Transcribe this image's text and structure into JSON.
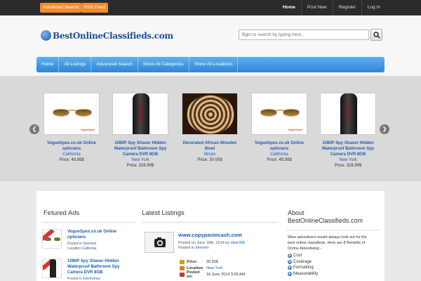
{
  "topbar": {
    "advanced_search": "Advanced Search",
    "rss_feed": "RSS Feed",
    "nav": [
      "Home",
      "Post New",
      "Register",
      "Log In"
    ]
  },
  "header": {
    "logo_text": "BestOnlineClassifieds.com",
    "search_placeholder": "Bgin to search by typing here...",
    "nav": [
      "Home",
      "All Listings",
      "Advanced Search",
      "Show All Categories",
      "Show All Locations"
    ]
  },
  "slider": {
    "items": [
      {
        "title_lines": [
          "VogueSpex.co.uk Online opticians",
          ""
        ],
        "location": "California",
        "price": "Price: 49.99$",
        "thumb": "sunglasses",
        "brand": "VogueSpex"
      },
      {
        "title_lines": [
          "1080P Spy Shaver Hidden",
          "Waterproof Bathroom Spy",
          "Camera DVR 8GB"
        ],
        "location": "New York",
        "price": "Price: 328.99$",
        "thumb": "shaver"
      },
      {
        "title_lines": [
          "Decorated African Wooden Bowl",
          ""
        ],
        "location": "Illinois",
        "price": "Price: 30.00$",
        "thumb": "bowl"
      },
      {
        "title_lines": [
          "VogueSpex.co.uk Online opticians",
          ""
        ],
        "location": "California",
        "price": "Price: 49.99$",
        "thumb": "sunglasses",
        "brand": "VogueSpex"
      },
      {
        "title_lines": [
          "1080P Spy Shaver Hidden",
          "Waterproof Bathroom Spy",
          "Camera DVR 8GB"
        ],
        "location": "New York",
        "price": "Price: 328.99$",
        "thumb": "shaver"
      }
    ]
  },
  "featured": {
    "title": "Fetured Ads",
    "items": [
      {
        "title_lines": [
          "VogueSpex.co.uk Online",
          "opticians"
        ],
        "posted_label": "Posted in",
        "category": "Services",
        "location_label": "Location",
        "location": "California"
      },
      {
        "title_lines": [
          "1080P Spy Shaver Hidden",
          "Waterproof Bathroom Spy",
          "Camera DVR 8GB"
        ],
        "posted_label": "Posted in",
        "category": "Electronics"
      }
    ]
  },
  "latest": {
    "title": "Latest Listings",
    "item": {
      "title": "www.copypastecash.com",
      "posted_on": "Posted on June 16th, 2014 by",
      "author": "disie306",
      "posted_in_label": "Posted in",
      "category": "Internet",
      "details": [
        {
          "label": "Price:",
          "value": "29.95$",
          "link": false,
          "color": "#d4a017"
        },
        {
          "label": "Location:",
          "value": "New York",
          "link": true,
          "color": "#e07b2a"
        },
        {
          "label": "Posted on:",
          "value": "16 June 2014 3:25 AM",
          "link": false,
          "color": "#c0392b"
        }
      ]
    }
  },
  "about": {
    "title_lines": [
      "About",
      "BestOnlineClassifieds.com"
    ],
    "text_lines": [
      "Wise advertisers would always look out for the",
      "best online classifieds. Here are 8 Benefits of",
      "Online Advertising:-"
    ],
    "list": [
      "Cost",
      "Coverage",
      "Formatting",
      "Measurability"
    ]
  },
  "colors": {
    "accent_orange": "#f28c2b",
    "nav_blue": "#2f86d8",
    "link_blue": "#1a5fb4",
    "topbar": "#2b2b2b"
  }
}
